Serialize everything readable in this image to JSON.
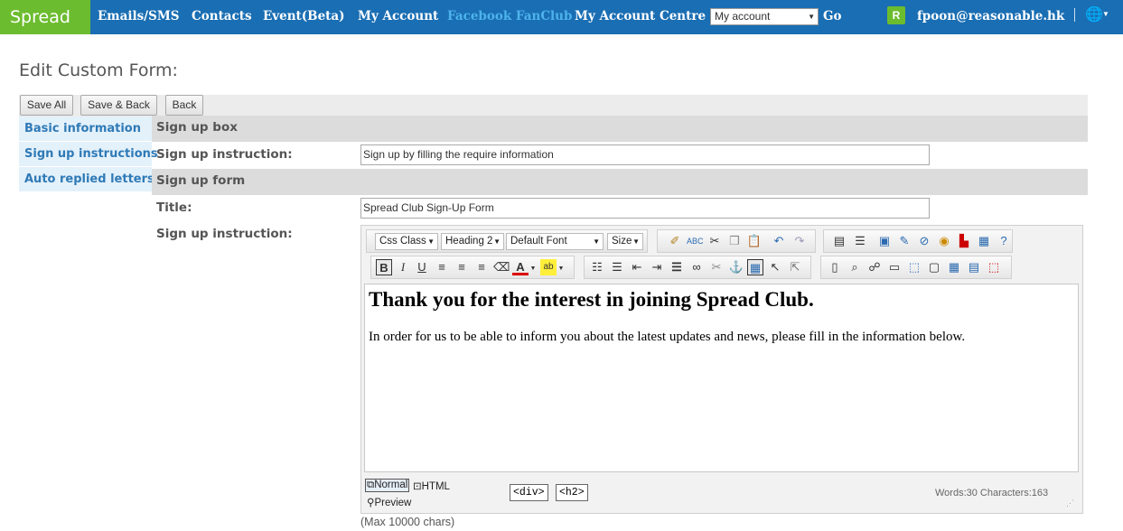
{
  "topbar": {
    "logo": "Spread",
    "nav": [
      "Emails/SMS",
      "Contacts",
      "Event(Beta)",
      "My Account",
      "Facebook FanClub"
    ],
    "account_centre_label": "My Account Centre :",
    "account_select_value": "My account",
    "go_label": "Go",
    "avatar_letter": "R",
    "user_email": "fpoon@reasonable.hk"
  },
  "page": {
    "title": "Edit Custom Form:"
  },
  "toolbar": {
    "save_all": "Save All",
    "save_back": "Save & Back",
    "back": "Back"
  },
  "tabs": [
    "Basic information",
    "Sign up instructions",
    "Auto replied letters"
  ],
  "form": {
    "signup_box_header": "Sign up box",
    "signup_instruction_label": "Sign up instruction:",
    "signup_instruction_value": "Sign up by filling the require information",
    "signup_form_header": "Sign up form",
    "title_label": "Title:",
    "title_value": "Spread Club Sign-Up Form",
    "instruction2_label": "Sign up instruction:",
    "max_chars": "(Max 10000 chars)"
  },
  "editor": {
    "css_class": "Css Class",
    "heading": "Heading 2",
    "font": "Default Font",
    "size": "Size",
    "content_heading": "Thank you for the interest in joining Spread Club.",
    "content_paragraph": "In order for us to be able to inform you about the latest updates and news, please fill in the information below.",
    "mode_normal": "Normal",
    "mode_html": "HTML",
    "mode_preview": "Preview",
    "tag_div": "<div>",
    "tag_h2": "<h2>",
    "stats": "Words:30 Characters:163"
  }
}
